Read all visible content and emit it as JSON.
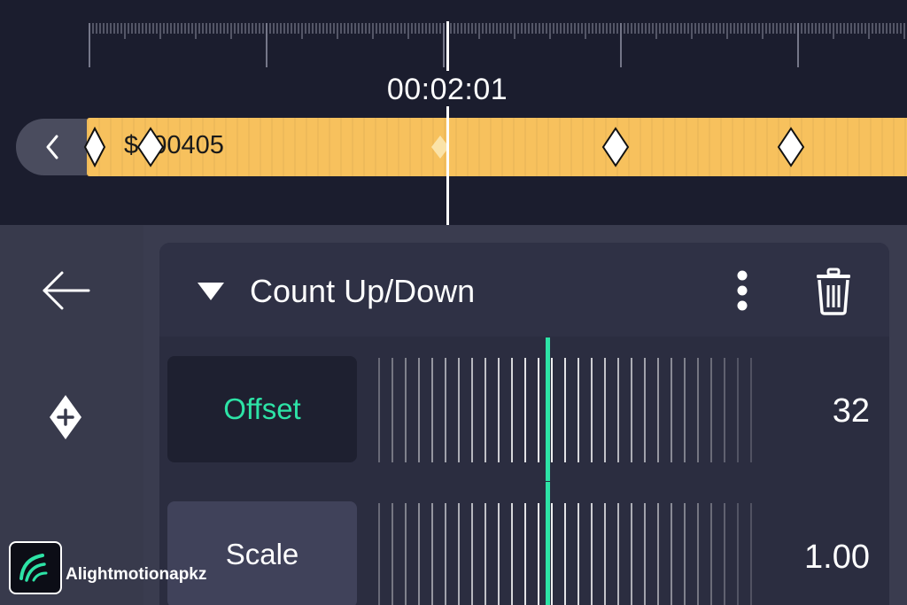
{
  "timeline": {
    "timecode": "00:02:01",
    "clip_name": "$400405",
    "keyframe_icon": "diamond-icon"
  },
  "left_rail": {
    "back_icon": "arrow-left-icon",
    "add_keyframe_icon": "add-keyframe-icon"
  },
  "effect": {
    "title": "Count Up/Down",
    "collapse_icon": "triangle-down-icon",
    "more_icon": "vertical-dots-icon",
    "delete_icon": "trash-icon",
    "params": [
      {
        "label": "Offset",
        "value": "32",
        "selected": true
      },
      {
        "label": "Scale",
        "value": "1.00",
        "selected": false
      }
    ]
  },
  "colors": {
    "accent": "#2de3a6",
    "clip": "#f7c15d",
    "background": "#1b1d2e",
    "panel": "#3a3c4f"
  },
  "watermark": {
    "text": "Alightmotionapkz"
  }
}
